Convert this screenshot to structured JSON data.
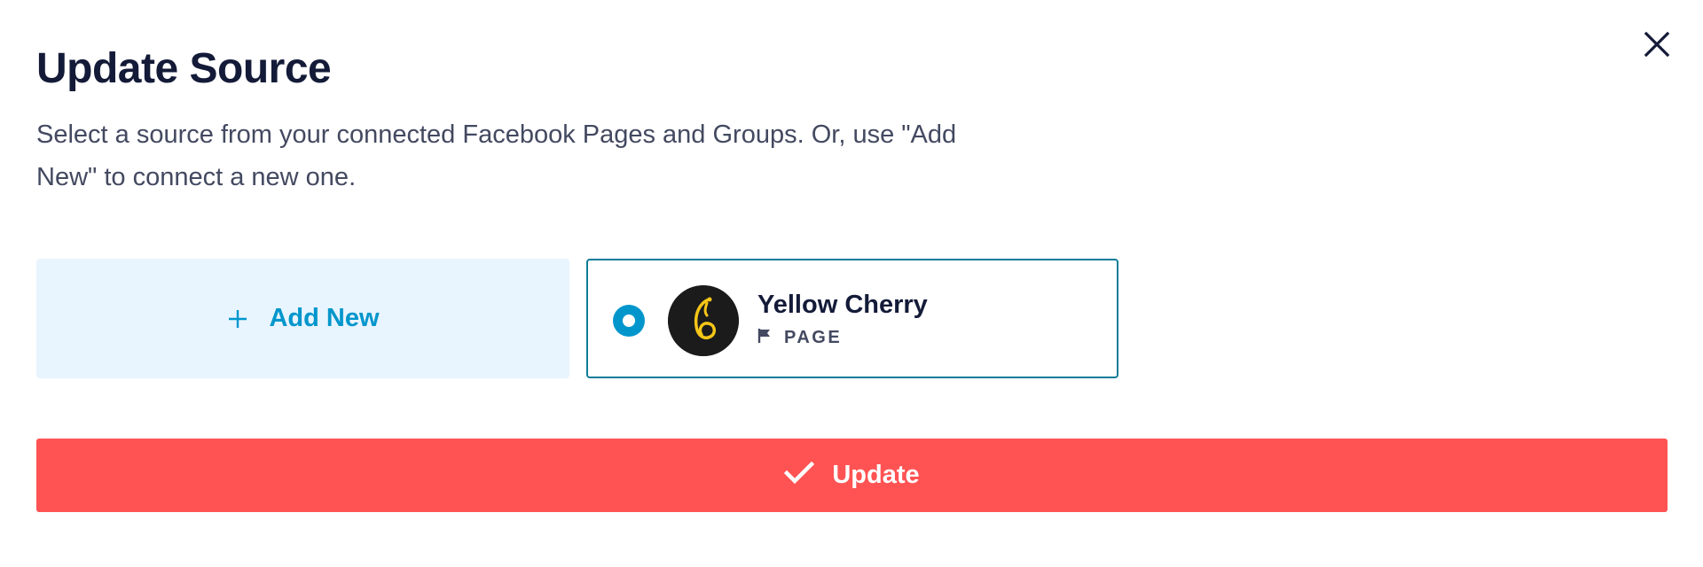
{
  "modal": {
    "title": "Update Source",
    "description": "Select a source from your connected Facebook Pages and Groups. Or, use \"Add New\" to connect a new one.",
    "close_icon": "close-icon"
  },
  "add_new": {
    "label": "Add New",
    "icon": "plus-icon"
  },
  "sources": [
    {
      "name": "Yellow Cherry",
      "type": "PAGE",
      "type_icon": "flag-icon",
      "selected": true
    }
  ],
  "update_button": {
    "label": "Update",
    "icon": "checkmark-icon"
  },
  "colors": {
    "accent_blue": "#0096cc",
    "card_border": "#0e7c99",
    "add_new_bg": "#e8f4fe",
    "update_red": "#ff5353",
    "title": "#141b38",
    "text": "#434960"
  }
}
